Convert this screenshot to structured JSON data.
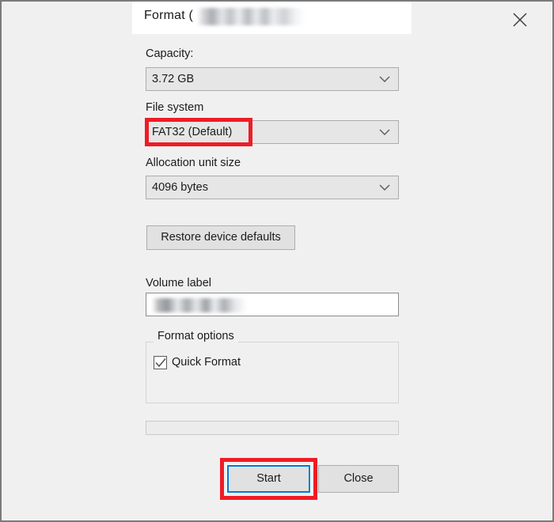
{
  "window": {
    "title_prefix": "Format (",
    "title_redacted": true,
    "close_icon": "close-icon"
  },
  "fields": {
    "capacity": {
      "label": "Capacity:",
      "value": "3.72 GB",
      "chevron_icon": "chevron-down-icon"
    },
    "file_system": {
      "label": "File system",
      "value": "FAT32 (Default)",
      "chevron_icon": "chevron-down-icon",
      "highlighted": true
    },
    "allocation_unit_size": {
      "label": "Allocation unit size",
      "value": "4096 bytes",
      "chevron_icon": "chevron-down-icon"
    },
    "volume_label": {
      "label": "Volume label",
      "value": "",
      "value_redacted": true
    }
  },
  "buttons": {
    "restore_defaults": "Restore device defaults",
    "start": "Start",
    "close": "Close"
  },
  "format_options": {
    "legend": "Format options",
    "quick_format": {
      "label": "Quick Format",
      "checked": true,
      "check_icon": "checkmark-icon"
    }
  },
  "progress": {
    "value": 0
  },
  "annotations": {
    "color": "#ef1c25",
    "targets": [
      "file-system-combo",
      "start-button"
    ]
  },
  "colors": {
    "accent_focus": "#0078d7",
    "annotation_red": "#ef1c25",
    "dialog_background": "#f0f0f0",
    "titlebar_background": "#ffffff"
  }
}
